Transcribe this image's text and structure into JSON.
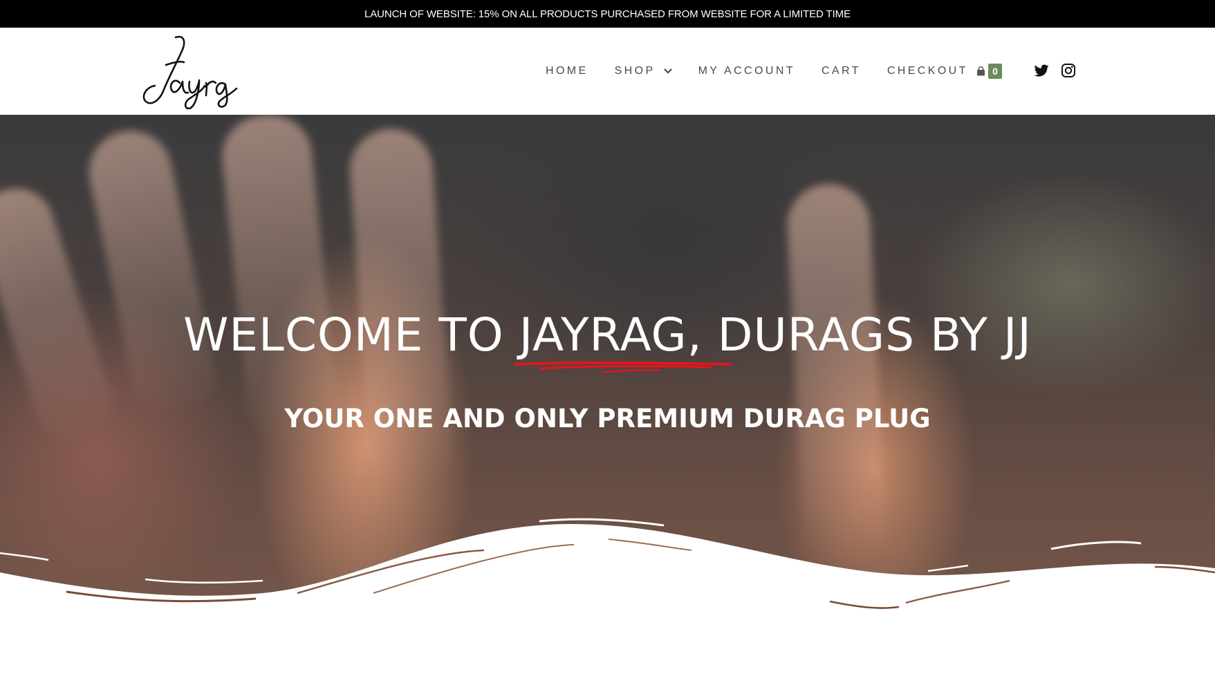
{
  "announcement": "LAUNCH OF WEBSITE: 15% ON ALL PRODUCTS PURCHASED FROM WEBSITE FOR A LIMITED TIME",
  "logo": {
    "text": "Jayrag"
  },
  "nav": {
    "items": [
      {
        "label": "HOME"
      },
      {
        "label": "SHOP",
        "has_dropdown": true
      },
      {
        "label": "MY ACCOUNT"
      },
      {
        "label": "CART"
      },
      {
        "label": "CHECKOUT"
      }
    ]
  },
  "cart": {
    "icon": "shopping-bag-icon",
    "count": "0",
    "badge_color": "#6a8a5a"
  },
  "social": [
    {
      "icon": "twitter-icon"
    },
    {
      "icon": "instagram-icon"
    }
  ],
  "hero": {
    "headline_prefix": "WELCOME TO ",
    "headline_accent": "JAYRAG,",
    "headline_suffix": " DURAGS BY JJ",
    "subheadline": "YOUR ONE AND ONLY PREMIUM DURAG PLUG",
    "accent_underline_color": "#e0161e"
  }
}
